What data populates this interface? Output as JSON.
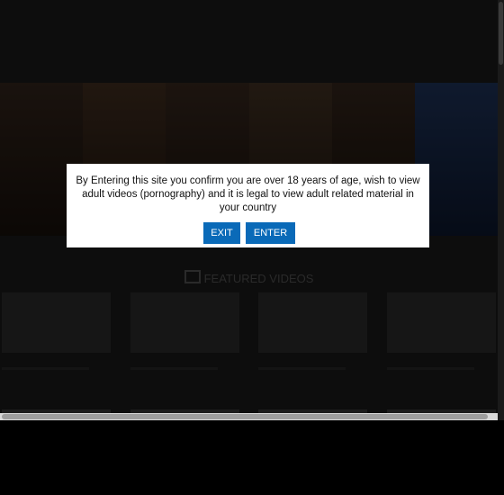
{
  "topbar": {
    "items": [
      "",
      "",
      ""
    ]
  },
  "header": {
    "logo": "",
    "tagline": ""
  },
  "nav": {
    "items": [
      "",
      "",
      "",
      "",
      "",
      "",
      ""
    ]
  },
  "section": {
    "title": "FEATURED VIDEOS"
  },
  "videos": [
    {
      "title": ""
    },
    {
      "title": ""
    },
    {
      "title": ""
    },
    {
      "title": ""
    }
  ],
  "colors": {
    "button": "#0a6ab8",
    "overlay": "#0d0d0d",
    "modal_bg": "#ffffff"
  },
  "modal": {
    "message": "By Entering this site you confirm you are over 18 years of age, wish to view adult videos (pornography) and it is legal to view adult related material in your country",
    "exit_label": "EXIT",
    "enter_label": "ENTER"
  }
}
